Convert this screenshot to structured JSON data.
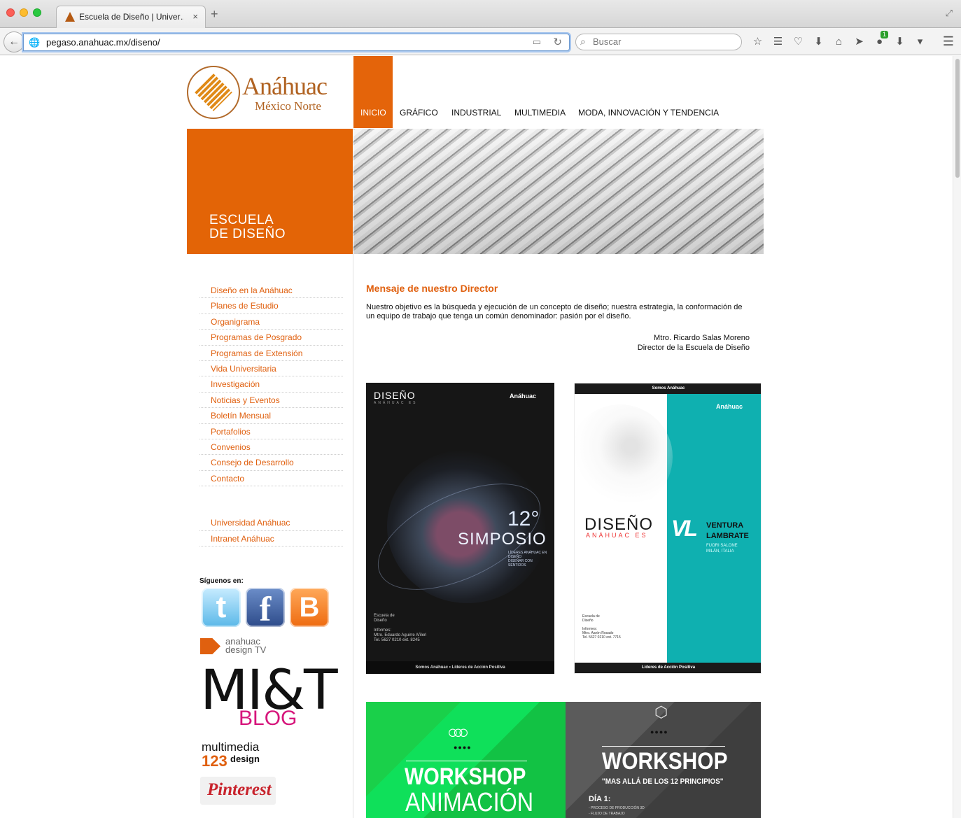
{
  "browser": {
    "tab_title": "Escuela de Diseño | Univer…",
    "url": "pegaso.anahuac.mx/diseno/",
    "search_placeholder": "Buscar",
    "badge_count": "1"
  },
  "site": {
    "logo_name": "Anáhuac",
    "logo_sub": "México Norte",
    "nav": {
      "active": "INICIO",
      "items": [
        "GRÁFICO",
        "INDUSTRIAL",
        "MULTIMEDIA",
        "MODA, INNOVACIÓN Y TENDENCIA"
      ]
    },
    "hero_text": "ESCUELA\nDE DISEÑO",
    "colors": {
      "accent": "#e36406",
      "link": "#e0600f"
    }
  },
  "sidebar": {
    "links": [
      "Diseño en la Anáhuac",
      "Planes de Estudio",
      "Organigrama",
      "Programas de Posgrado",
      "Programas de Extensión",
      "Vida Universitaria",
      "Investigación",
      "Noticias y Eventos",
      "Boletín Mensual",
      "Portafolios",
      "Convenios",
      "Consejo de Desarrollo",
      "Contacto"
    ],
    "links2": [
      "Universidad Anáhuac",
      "Intranet Anáhuac"
    ],
    "follow_label": "Síguenos en:",
    "social": {
      "twitter": "t",
      "facebook": "f",
      "blogger": "B"
    },
    "adtv": "anahuac\ndesign TV",
    "mit": "MI&T",
    "mit_blog": "BLOG",
    "multimedia": "multimedia",
    "mm_num": "123",
    "mm_design": "design",
    "pinterest": "Pinterest"
  },
  "main": {
    "title": "Mensaje de nuestro Director",
    "body": "Nuestro objetivo es la búsqueda y ejecución de un concepto de diseño; nuestra estrategia, la conformación de un equipo de trabajo que tenga un común denominador: pasión por el diseño.",
    "sig_name": "Mtro. Ricardo Salas Moreno",
    "sig_role": "Director de la Escuela de Diseño"
  },
  "posters": {
    "p1": {
      "title": "DISEÑO",
      "sub": "ANÁHUAC ES",
      "logo": "Anáhuac",
      "num": "12°",
      "word": "SIMPOSIO",
      "small": "LÍDERES ANÁHUAC EN DISEÑO\nDISEÑAR CON\nSENTIDOS",
      "foot": "Escuela de\nDiseño\n\nInformes:\nMtro. Eduardo Aguirre Añleri\nTel. 5627 0210 ext. 8245",
      "bottom": "Somos Anáhuac • Líderes de Acción Positiva"
    },
    "p2": {
      "top": "Somos Anáhuac",
      "logo": "Anáhuac",
      "diseno": "DISEÑO",
      "anahuac": "ANÁHUAC ES",
      "vl": "VL",
      "vname": "VENTURA\nLAMBRATE",
      "vsub": "FUORI SALONE\nMILÁN, ITALIA",
      "foot": "Escuela de\nDiseño\n\nInformes:\nMtro. Aarón Rosado\nTel. 5627 0210 ext. 7715",
      "bottom": "Líderes de Acción Positiva"
    },
    "p3": {
      "rings": "○○○",
      "dots": "●●●●",
      "w1": "WORKSHOP",
      "w2": "ANIMACIÓN"
    },
    "p4": {
      "cube": "⬡",
      "dots": "●●●●",
      "w1": "WORKSHOP",
      "w2": "\"MAS ALLÁ DE LOS 12 PRINCIPIOS\"",
      "dia": "DÍA 1:",
      "list": "- PROCESO DE PRODUCCIÓN 3D\n- FLUJO DE TRABAJO"
    }
  }
}
